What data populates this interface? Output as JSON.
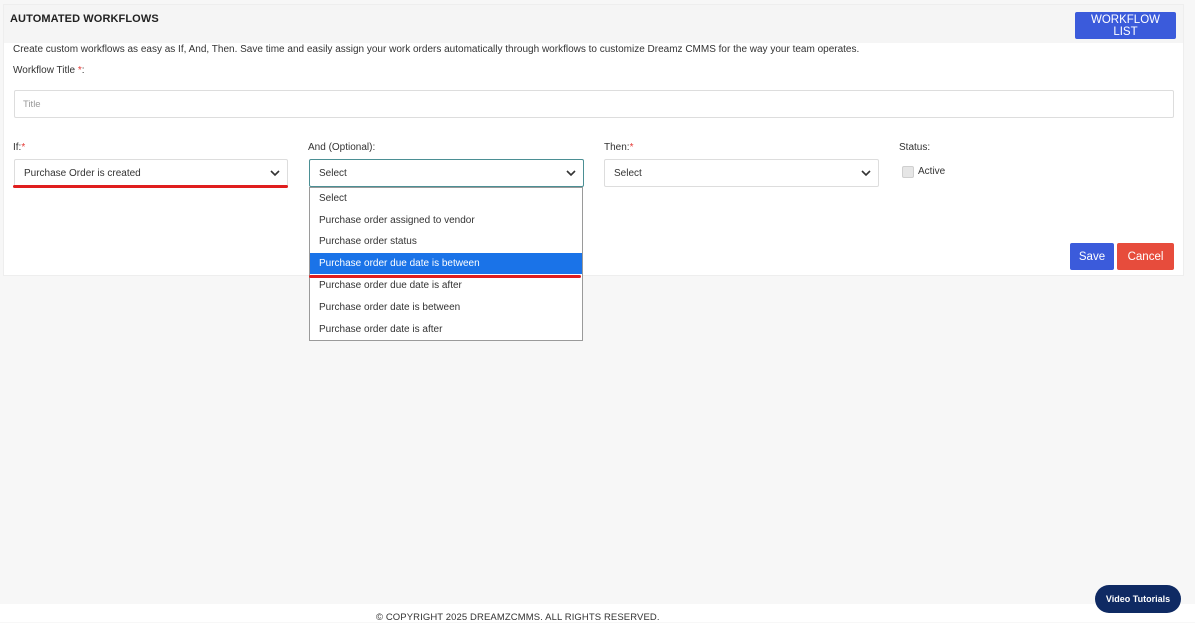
{
  "header": {
    "title": "AUTOMATED WORKFLOWS",
    "workflow_list_label": "WORKFLOW LIST"
  },
  "description": "Create custom workflows as easy as If, And, Then. Save time and easily assign your work orders automatically through workflows to customize Dreamz CMMS for the way your team operates.",
  "form": {
    "title_label": "Workflow Title",
    "required_mark": "*",
    "title_suffix": ":",
    "title_placeholder": "Title",
    "if_label": "If:",
    "and_label": "And (Optional):",
    "then_label": "Then:",
    "status_label": "Status:",
    "if_value": "Purchase Order is created",
    "and_value": "Select",
    "then_value": "Select",
    "active_label": "Active",
    "active_checked": false
  },
  "and_dropdown": {
    "options": [
      "Select",
      "Purchase order assigned to vendor",
      "Purchase order status",
      "Purchase order due date is between",
      "Purchase order due date is after",
      "Purchase order date is between",
      "Purchase order date is after"
    ],
    "highlighted": "Purchase order due date is between"
  },
  "actions": {
    "save_label": "Save",
    "cancel_label": "Cancel"
  },
  "footer": {
    "copyright": "© COPYRIGHT 2025 DREAMZCMMS. ALL RIGHTS RESERVED.",
    "video_tutorials_label": "Video Tutorials"
  },
  "colors": {
    "primary": "#3b5bdb",
    "danger": "#e74c3c",
    "highlight": "#1a73e8",
    "annotation_red": "#e01e1e",
    "video_button": "#0f2a63"
  }
}
